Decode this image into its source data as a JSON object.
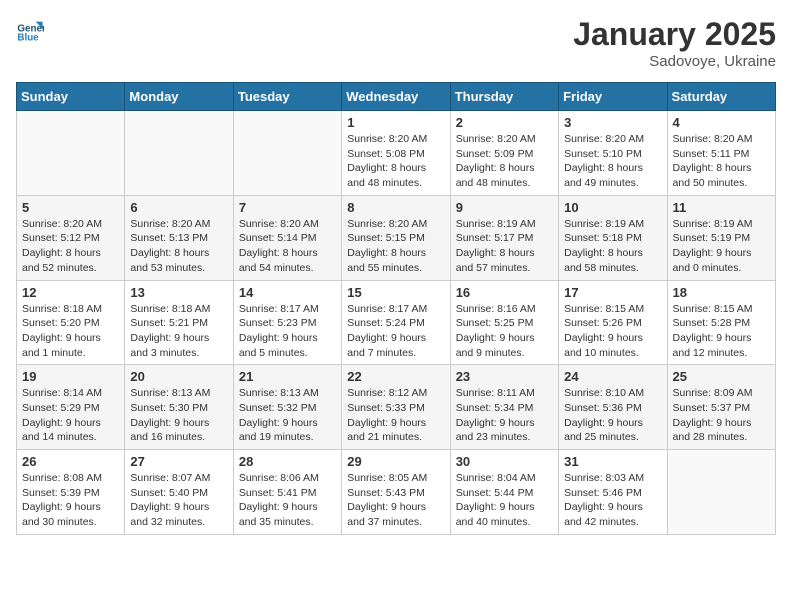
{
  "header": {
    "logo_general": "General",
    "logo_blue": "Blue",
    "month_title": "January 2025",
    "location": "Sadovoye, Ukraine"
  },
  "weekdays": [
    "Sunday",
    "Monday",
    "Tuesday",
    "Wednesday",
    "Thursday",
    "Friday",
    "Saturday"
  ],
  "weeks": [
    [
      {
        "day": "",
        "sunrise": "",
        "sunset": "",
        "daylight": ""
      },
      {
        "day": "",
        "sunrise": "",
        "sunset": "",
        "daylight": ""
      },
      {
        "day": "",
        "sunrise": "",
        "sunset": "",
        "daylight": ""
      },
      {
        "day": "1",
        "sunrise": "8:20 AM",
        "sunset": "5:08 PM",
        "daylight": "8 hours and 48 minutes."
      },
      {
        "day": "2",
        "sunrise": "8:20 AM",
        "sunset": "5:09 PM",
        "daylight": "8 hours and 48 minutes."
      },
      {
        "day": "3",
        "sunrise": "8:20 AM",
        "sunset": "5:10 PM",
        "daylight": "8 hours and 49 minutes."
      },
      {
        "day": "4",
        "sunrise": "8:20 AM",
        "sunset": "5:11 PM",
        "daylight": "8 hours and 50 minutes."
      }
    ],
    [
      {
        "day": "5",
        "sunrise": "8:20 AM",
        "sunset": "5:12 PM",
        "daylight": "8 hours and 52 minutes."
      },
      {
        "day": "6",
        "sunrise": "8:20 AM",
        "sunset": "5:13 PM",
        "daylight": "8 hours and 53 minutes."
      },
      {
        "day": "7",
        "sunrise": "8:20 AM",
        "sunset": "5:14 PM",
        "daylight": "8 hours and 54 minutes."
      },
      {
        "day": "8",
        "sunrise": "8:20 AM",
        "sunset": "5:15 PM",
        "daylight": "8 hours and 55 minutes."
      },
      {
        "day": "9",
        "sunrise": "8:19 AM",
        "sunset": "5:17 PM",
        "daylight": "8 hours and 57 minutes."
      },
      {
        "day": "10",
        "sunrise": "8:19 AM",
        "sunset": "5:18 PM",
        "daylight": "8 hours and 58 minutes."
      },
      {
        "day": "11",
        "sunrise": "8:19 AM",
        "sunset": "5:19 PM",
        "daylight": "9 hours and 0 minutes."
      }
    ],
    [
      {
        "day": "12",
        "sunrise": "8:18 AM",
        "sunset": "5:20 PM",
        "daylight": "9 hours and 1 minute."
      },
      {
        "day": "13",
        "sunrise": "8:18 AM",
        "sunset": "5:21 PM",
        "daylight": "9 hours and 3 minutes."
      },
      {
        "day": "14",
        "sunrise": "8:17 AM",
        "sunset": "5:23 PM",
        "daylight": "9 hours and 5 minutes."
      },
      {
        "day": "15",
        "sunrise": "8:17 AM",
        "sunset": "5:24 PM",
        "daylight": "9 hours and 7 minutes."
      },
      {
        "day": "16",
        "sunrise": "8:16 AM",
        "sunset": "5:25 PM",
        "daylight": "9 hours and 9 minutes."
      },
      {
        "day": "17",
        "sunrise": "8:15 AM",
        "sunset": "5:26 PM",
        "daylight": "9 hours and 10 minutes."
      },
      {
        "day": "18",
        "sunrise": "8:15 AM",
        "sunset": "5:28 PM",
        "daylight": "9 hours and 12 minutes."
      }
    ],
    [
      {
        "day": "19",
        "sunrise": "8:14 AM",
        "sunset": "5:29 PM",
        "daylight": "9 hours and 14 minutes."
      },
      {
        "day": "20",
        "sunrise": "8:13 AM",
        "sunset": "5:30 PM",
        "daylight": "9 hours and 16 minutes."
      },
      {
        "day": "21",
        "sunrise": "8:13 AM",
        "sunset": "5:32 PM",
        "daylight": "9 hours and 19 minutes."
      },
      {
        "day": "22",
        "sunrise": "8:12 AM",
        "sunset": "5:33 PM",
        "daylight": "9 hours and 21 minutes."
      },
      {
        "day": "23",
        "sunrise": "8:11 AM",
        "sunset": "5:34 PM",
        "daylight": "9 hours and 23 minutes."
      },
      {
        "day": "24",
        "sunrise": "8:10 AM",
        "sunset": "5:36 PM",
        "daylight": "9 hours and 25 minutes."
      },
      {
        "day": "25",
        "sunrise": "8:09 AM",
        "sunset": "5:37 PM",
        "daylight": "9 hours and 28 minutes."
      }
    ],
    [
      {
        "day": "26",
        "sunrise": "8:08 AM",
        "sunset": "5:39 PM",
        "daylight": "9 hours and 30 minutes."
      },
      {
        "day": "27",
        "sunrise": "8:07 AM",
        "sunset": "5:40 PM",
        "daylight": "9 hours and 32 minutes."
      },
      {
        "day": "28",
        "sunrise": "8:06 AM",
        "sunset": "5:41 PM",
        "daylight": "9 hours and 35 minutes."
      },
      {
        "day": "29",
        "sunrise": "8:05 AM",
        "sunset": "5:43 PM",
        "daylight": "9 hours and 37 minutes."
      },
      {
        "day": "30",
        "sunrise": "8:04 AM",
        "sunset": "5:44 PM",
        "daylight": "9 hours and 40 minutes."
      },
      {
        "day": "31",
        "sunrise": "8:03 AM",
        "sunset": "5:46 PM",
        "daylight": "9 hours and 42 minutes."
      },
      {
        "day": "",
        "sunrise": "",
        "sunset": "",
        "daylight": ""
      }
    ]
  ]
}
